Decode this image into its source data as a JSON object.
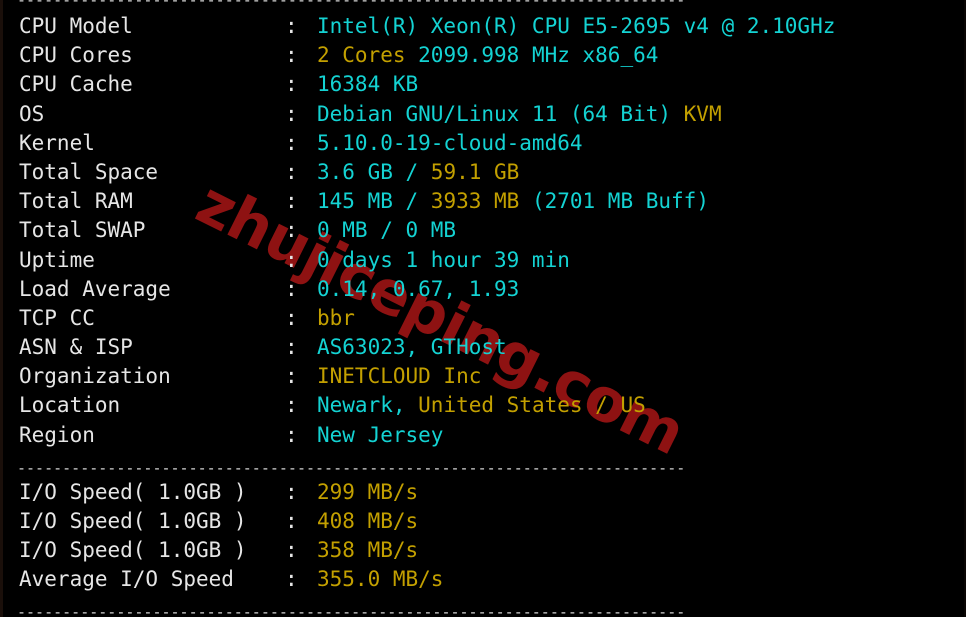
{
  "terminal": {
    "background_color": "#000000",
    "cyan_color": "#14d3d3",
    "yellow_color": "#c3a000",
    "white_color": "#e6e6e6",
    "watermark_color": "#8e1212",
    "separator": "--------------------------------------------------------------------------",
    "colon": ":"
  },
  "watermark": {
    "text": "zhujiceping.com"
  },
  "system_info": {
    "rows": [
      {
        "label": "CPU Model",
        "segments": [
          {
            "text": "Intel(R) Xeon(R) CPU E5-2695 v4 @ 2.10GHz",
            "color": "cyan"
          }
        ]
      },
      {
        "label": "CPU Cores",
        "segments": [
          {
            "text": "2 Cores ",
            "color": "yellow"
          },
          {
            "text": "2099.998 MHz x86_64",
            "color": "cyan"
          }
        ]
      },
      {
        "label": "CPU Cache",
        "segments": [
          {
            "text": "16384 KB",
            "color": "cyan"
          }
        ]
      },
      {
        "label": "OS",
        "segments": [
          {
            "text": "Debian GNU/Linux 11 (64 Bit) ",
            "color": "cyan"
          },
          {
            "text": "KVM",
            "color": "yellow"
          }
        ]
      },
      {
        "label": "Kernel",
        "segments": [
          {
            "text": "5.10.0-19-cloud-amd64",
            "color": "cyan"
          }
        ]
      },
      {
        "label": "Total Space",
        "segments": [
          {
            "text": "3.6 GB / ",
            "color": "cyan"
          },
          {
            "text": "59.1 GB",
            "color": "yellow"
          }
        ]
      },
      {
        "label": "Total RAM",
        "segments": [
          {
            "text": "145 MB / ",
            "color": "cyan"
          },
          {
            "text": "3933 MB ",
            "color": "yellow"
          },
          {
            "text": "(2701 MB Buff)",
            "color": "cyan"
          }
        ]
      },
      {
        "label": "Total SWAP",
        "segments": [
          {
            "text": "0 MB / 0 MB",
            "color": "cyan"
          }
        ]
      },
      {
        "label": "Uptime",
        "segments": [
          {
            "text": "0 days 1 hour 39 min",
            "color": "cyan"
          }
        ]
      },
      {
        "label": "Load Average",
        "segments": [
          {
            "text": "0.14, 0.67, 1.93",
            "color": "cyan"
          }
        ]
      },
      {
        "label": "TCP CC",
        "segments": [
          {
            "text": "bbr",
            "color": "yellow"
          }
        ]
      },
      {
        "label": "ASN & ISP",
        "segments": [
          {
            "text": "AS63023, GTHost",
            "color": "cyan"
          }
        ]
      },
      {
        "label": "Organization",
        "segments": [
          {
            "text": "INETCLOUD Inc",
            "color": "yellow"
          }
        ]
      },
      {
        "label": "Location",
        "segments": [
          {
            "text": "Newark, ",
            "color": "cyan"
          },
          {
            "text": "United States / US",
            "color": "yellow"
          }
        ]
      },
      {
        "label": "Region",
        "segments": [
          {
            "text": "New Jersey",
            "color": "cyan"
          }
        ]
      }
    ]
  },
  "io_results": {
    "rows": [
      {
        "label": "I/O Speed( 1.0GB )",
        "segments": [
          {
            "text": "299 MB/s",
            "color": "yellow"
          }
        ]
      },
      {
        "label": "I/O Speed( 1.0GB )",
        "segments": [
          {
            "text": "408 MB/s",
            "color": "yellow"
          }
        ]
      },
      {
        "label": "I/O Speed( 1.0GB )",
        "segments": [
          {
            "text": "358 MB/s",
            "color": "yellow"
          }
        ]
      },
      {
        "label": "Average I/O Speed",
        "segments": [
          {
            "text": "355.0 MB/s",
            "color": "yellow"
          }
        ]
      }
    ]
  }
}
